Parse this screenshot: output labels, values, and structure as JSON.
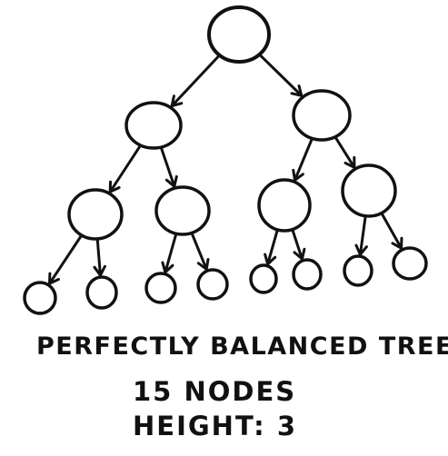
{
  "diagram": {
    "type": "binary-tree",
    "stroke_color": "#111111",
    "background_color": "#ffffff",
    "node_count": 15,
    "tree_height": 3,
    "levels": [
      [
        "root"
      ],
      [
        "L",
        "R"
      ],
      [
        "LL",
        "LR",
        "RL",
        "RR"
      ],
      [
        "LLL",
        "LLR",
        "LRL",
        "LRR",
        "RLL",
        "RLR",
        "RRL",
        "RRR"
      ]
    ],
    "edges": [
      [
        "root",
        "L"
      ],
      [
        "root",
        "R"
      ],
      [
        "L",
        "LL"
      ],
      [
        "L",
        "LR"
      ],
      [
        "R",
        "RL"
      ],
      [
        "R",
        "RR"
      ],
      [
        "LL",
        "LLL"
      ],
      [
        "LL",
        "LLR"
      ],
      [
        "LR",
        "LRL"
      ],
      [
        "LR",
        "LRR"
      ],
      [
        "RL",
        "RLL"
      ],
      [
        "RL",
        "RLR"
      ],
      [
        "RR",
        "RRL"
      ],
      [
        "RR",
        "RRR"
      ]
    ]
  },
  "captions": {
    "title": "PERFECTLY BALANCED TREE",
    "nodes": "15 NODES",
    "height": "HEIGHT: 3"
  }
}
